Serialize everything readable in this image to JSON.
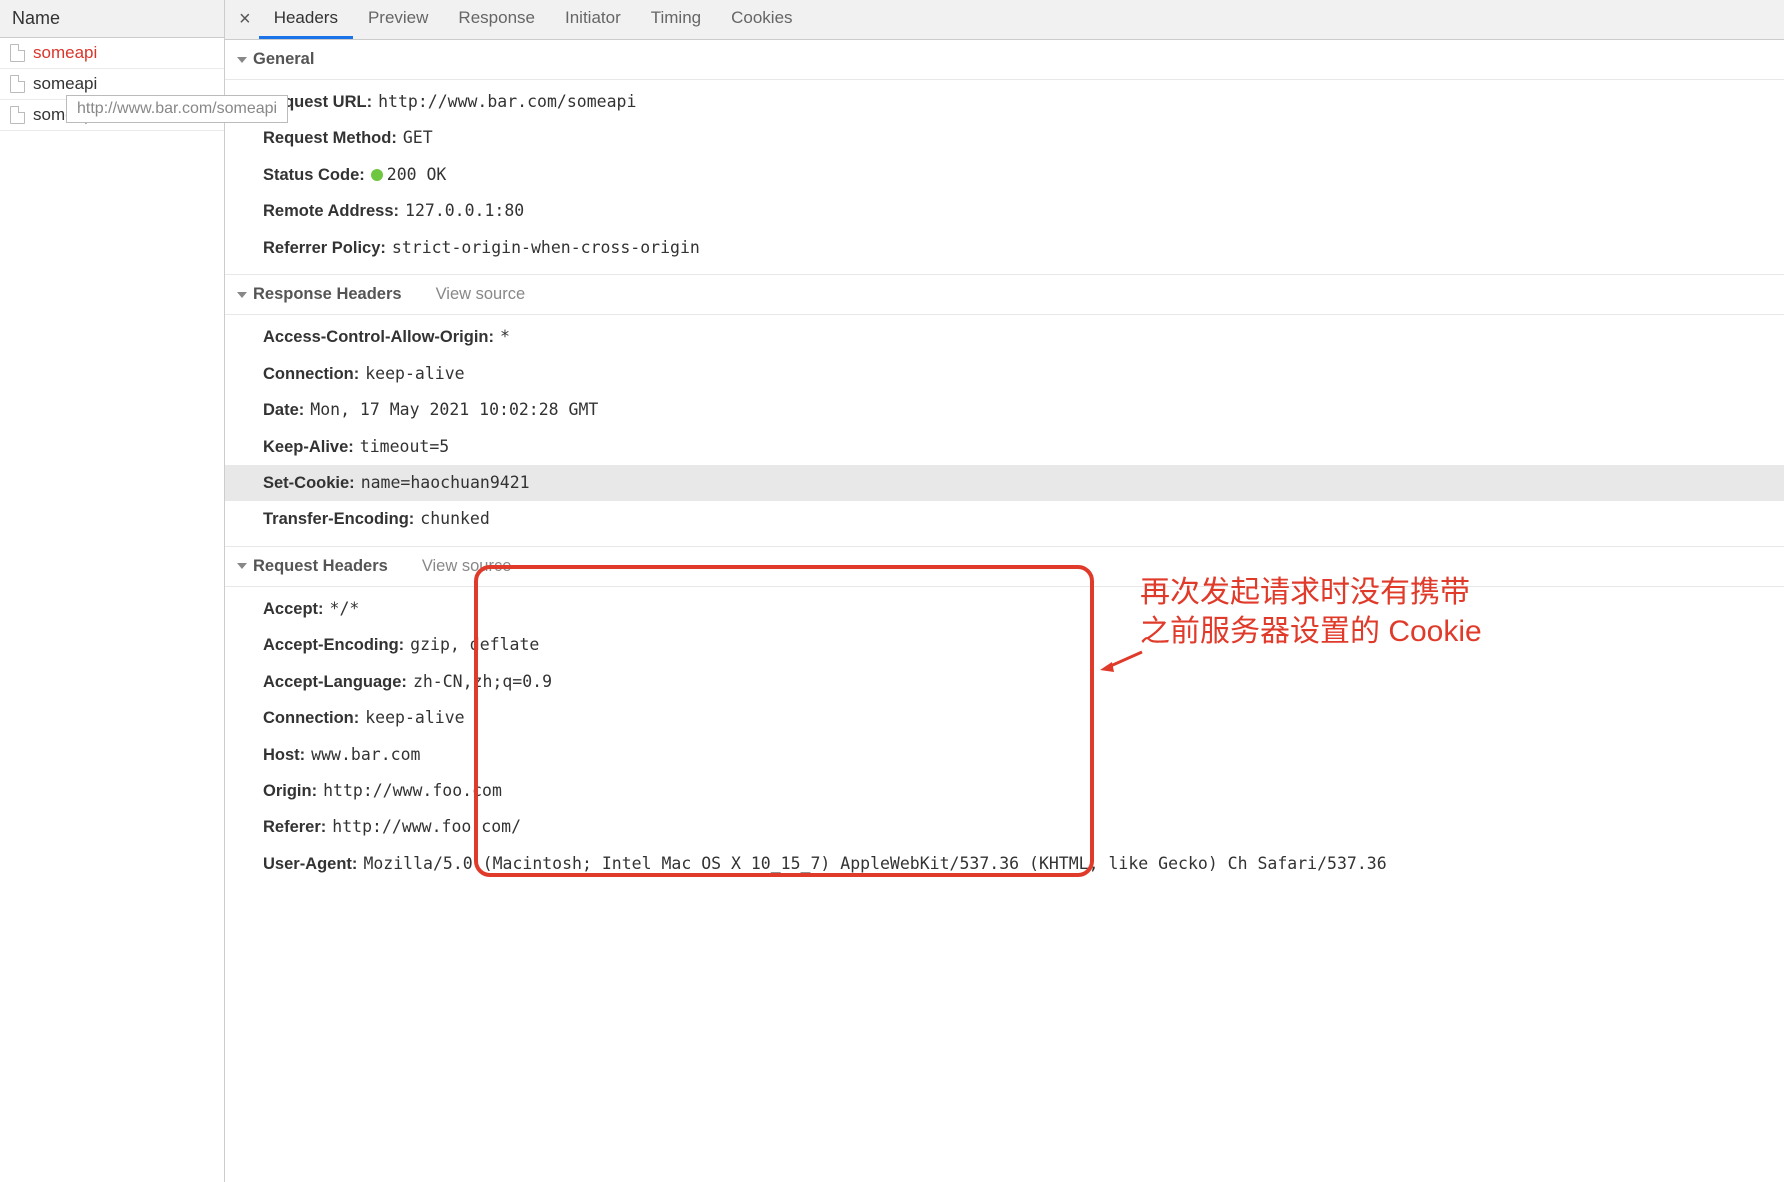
{
  "sidebar": {
    "header": "Name",
    "items": [
      {
        "label": "someapi",
        "selected": true
      },
      {
        "label": "someapi",
        "selected": false
      },
      {
        "label": "someapi",
        "selected": false
      }
    ],
    "tooltip": "http://www.bar.com/someapi"
  },
  "tabs": {
    "items": [
      {
        "label": "Headers",
        "id": "headers",
        "active": true
      },
      {
        "label": "Preview",
        "id": "preview",
        "active": false
      },
      {
        "label": "Response",
        "id": "response",
        "active": false
      },
      {
        "label": "Initiator",
        "id": "initiator",
        "active": false
      },
      {
        "label": "Timing",
        "id": "timing",
        "active": false
      },
      {
        "label": "Cookies",
        "id": "cookies",
        "active": false
      }
    ]
  },
  "sections": {
    "general": {
      "title": "General",
      "items": [
        {
          "k": "Request URL:",
          "v": "http://www.bar.com/someapi"
        },
        {
          "k": "Request Method:",
          "v": "GET"
        },
        {
          "k": "Status Code:",
          "v": "200 OK",
          "status": true
        },
        {
          "k": "Remote Address:",
          "v": "127.0.0.1:80"
        },
        {
          "k": "Referrer Policy:",
          "v": "strict-origin-when-cross-origin"
        }
      ]
    },
    "response": {
      "title": "Response Headers",
      "view_source": "View source",
      "items": [
        {
          "k": "Access-Control-Allow-Origin:",
          "v": "*"
        },
        {
          "k": "Connection:",
          "v": "keep-alive"
        },
        {
          "k": "Date:",
          "v": "Mon, 17 May 2021 10:02:28 GMT"
        },
        {
          "k": "Keep-Alive:",
          "v": "timeout=5"
        },
        {
          "k": "Set-Cookie:",
          "v": "name=haochuan9421",
          "highlight": true
        },
        {
          "k": "Transfer-Encoding:",
          "v": "chunked"
        }
      ]
    },
    "request": {
      "title": "Request Headers",
      "view_source": "View source",
      "items": [
        {
          "k": "Accept:",
          "v": "*/*"
        },
        {
          "k": "Accept-Encoding:",
          "v": "gzip, deflate"
        },
        {
          "k": "Accept-Language:",
          "v": "zh-CN,zh;q=0.9"
        },
        {
          "k": "Connection:",
          "v": "keep-alive"
        },
        {
          "k": "Host:",
          "v": "www.bar.com"
        },
        {
          "k": "Origin:",
          "v": "http://www.foo.com"
        },
        {
          "k": "Referer:",
          "v": "http://www.foo.com/"
        },
        {
          "k": "User-Agent:",
          "v": "Mozilla/5.0 (Macintosh; Intel Mac OS X 10_15_7) AppleWebKit/537.36 (KHTML, like Gecko) Ch Safari/537.36"
        }
      ]
    }
  },
  "annotation": {
    "line1": "再次发起请求时没有携带",
    "line2": "之前服务器设置的 Cookie"
  }
}
